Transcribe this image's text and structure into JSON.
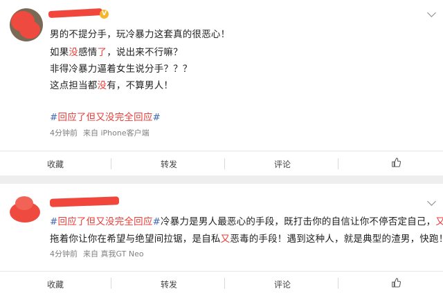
{
  "posts": [
    {
      "name_suffix": "",
      "vip_glyph": "V",
      "content_lines": [
        [
          {
            "t": "男的不提分手，玩冷暴力这套真的很恶心！",
            "c": ""
          }
        ],
        [
          {
            "t": "如果",
            "c": ""
          },
          {
            "t": "没",
            "c": "red"
          },
          {
            "t": "感情",
            "c": ""
          },
          {
            "t": "了",
            "c": "red"
          },
          {
            "t": "，说出来不行嘛？",
            "c": ""
          }
        ],
        [
          {
            "t": "非得冷暴力逼着女生说分手？？？",
            "c": ""
          }
        ],
        [
          {
            "t": "这点担当都",
            "c": ""
          },
          {
            "t": "没",
            "c": "red"
          },
          {
            "t": "有，不算男人！",
            "c": ""
          }
        ]
      ],
      "hashtag": {
        "hash": "#",
        "pre": "回应了但",
        "mid": "又",
        "post": "没",
        "tail": "完全回应",
        "end": "#"
      },
      "time": "4分钟前",
      "source": "来自 iPhone客户端",
      "actions": {
        "fav": "收藏",
        "repost": "转发",
        "comment": "评论"
      }
    },
    {
      "name_suffix": "",
      "line1": [
        {
          "t": "#",
          "c": "blue"
        },
        {
          "t": "回应了但又没完全回应",
          "c": "red"
        },
        {
          "t": "#",
          "c": "blue"
        },
        {
          "t": "冷暴力是男人最恶心的手段，既打击你的自信让你不停否定自己，",
          "c": ""
        },
        {
          "t": "又",
          "c": "red"
        }
      ],
      "line2": [
        {
          "t": "拖着你让你在希望与绝望间拉锯，是自私",
          "c": ""
        },
        {
          "t": "又",
          "c": "red"
        },
        {
          "t": "恶毒的手段！遇到这种人，就是典型的渣男，快跑！",
          "c": ""
        }
      ],
      "time": "4分钟前",
      "source": "来自 真我GT Neo",
      "actions": {
        "fav": "收藏",
        "repost": "转发",
        "comment": "评论"
      }
    }
  ],
  "icons": {
    "more": "chevron-down-icon",
    "like": "thumbs-up-icon"
  },
  "colors": {
    "accent_red": "#eb3b36",
    "topic_blue": "#3d68b3",
    "page_bg": "#eeeeee"
  }
}
